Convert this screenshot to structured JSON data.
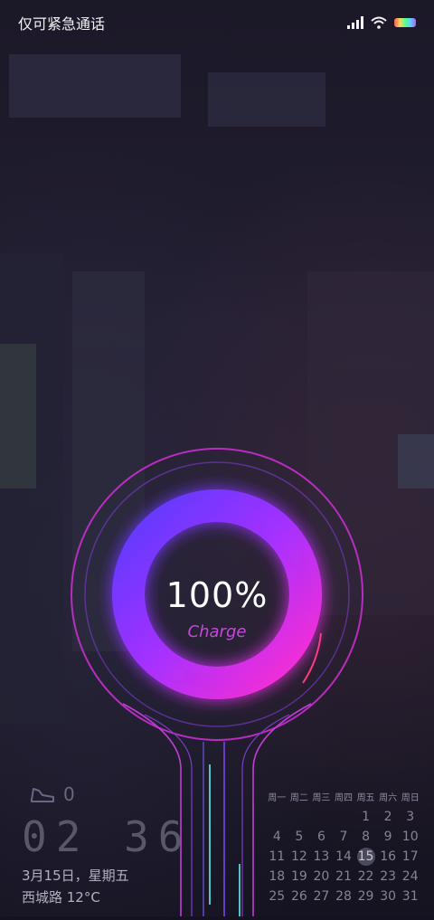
{
  "status_bar": {
    "emergency_text": "仅可紧急通话"
  },
  "charging": {
    "percent": "100%",
    "label": "Charge",
    "level": 1.0
  },
  "widget": {
    "steps": "0",
    "time": "02 36",
    "date": "3月15日，星期五",
    "weather": "西城路 12°C"
  },
  "calendar": {
    "weekdays": [
      "周一",
      "周二",
      "周三",
      "周四",
      "周五",
      "周六",
      "周日"
    ],
    "weeks": [
      [
        "",
        "",
        "",
        "",
        "1",
        "2",
        "3"
      ],
      [
        "4",
        "5",
        "6",
        "7",
        "8",
        "9",
        "10"
      ],
      [
        "11",
        "12",
        "13",
        "14",
        "15",
        "16",
        "17"
      ],
      [
        "18",
        "19",
        "20",
        "21",
        "22",
        "23",
        "24"
      ],
      [
        "25",
        "26",
        "27",
        "28",
        "29",
        "30",
        "31"
      ]
    ],
    "today": "15"
  },
  "colors": {
    "ring_start": "#6a3bff",
    "ring_end": "#ff2fd0",
    "accent": "#c34ad9"
  }
}
